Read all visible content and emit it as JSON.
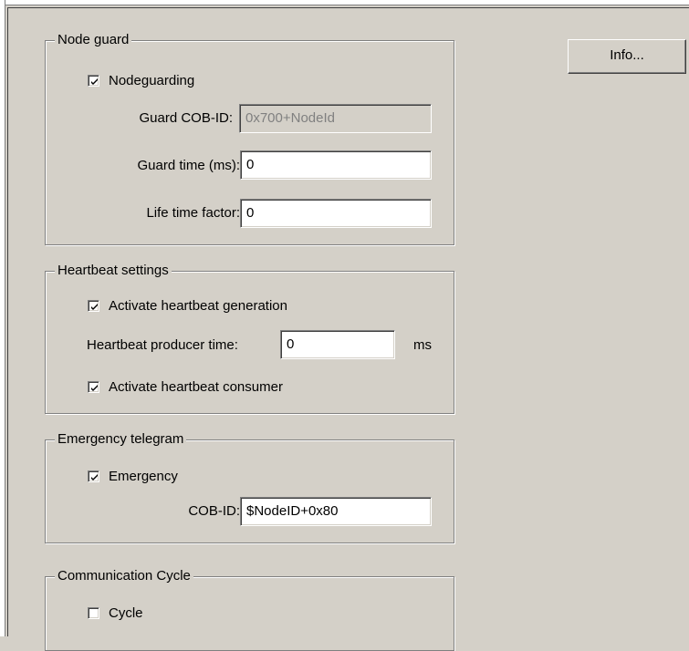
{
  "info_button": {
    "label": "Info..."
  },
  "node_guard": {
    "title": "Node guard",
    "nodeguarding": {
      "label": "Nodeguarding",
      "checked": true
    },
    "guard_cob_id": {
      "label": "Guard COB-ID:",
      "value": "0x700+NodeId",
      "enabled": false
    },
    "guard_time": {
      "label": "Guard time (ms):",
      "value": "0"
    },
    "life_time_factor": {
      "label": "Life time factor:",
      "value": "0"
    }
  },
  "heartbeat": {
    "title": "Heartbeat settings",
    "generation": {
      "label": "Activate heartbeat generation",
      "checked": true
    },
    "producer_time": {
      "label": "Heartbeat producer time:",
      "value": "0",
      "unit": "ms"
    },
    "consumer": {
      "label": "Activate heartbeat consumer",
      "checked": true
    }
  },
  "emergency": {
    "title": "Emergency telegram",
    "emergency": {
      "label": "Emergency",
      "checked": true
    },
    "cob_id": {
      "label": "COB-ID:",
      "value": "$NodeID+0x80"
    }
  },
  "communication_cycle": {
    "title": "Communication Cycle",
    "cycle": {
      "label": "Cycle",
      "checked": false
    }
  },
  "icons": {
    "checkbox_mark": "checkmark-icon"
  }
}
